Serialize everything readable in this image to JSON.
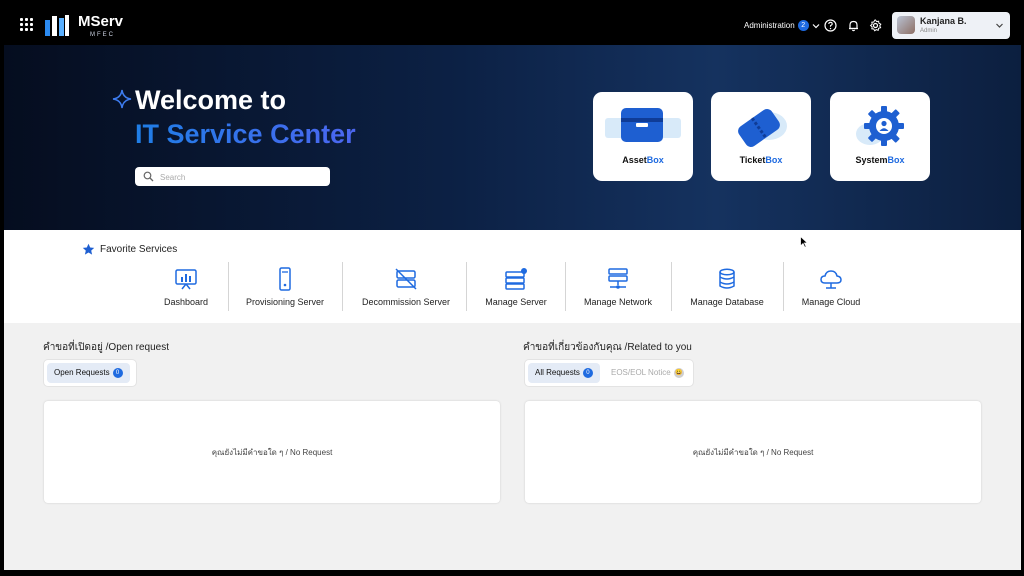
{
  "header": {
    "brand": "MServ",
    "brand_sub": "MFEC",
    "admin_label": "Administration",
    "admin_count": "2",
    "user_name": "Kanjana B.",
    "user_role": "Admin"
  },
  "hero": {
    "title_line1": "Welcome to",
    "title_line2": "IT Service Center",
    "search_placeholder": "Search",
    "boxes": [
      {
        "name": "Asset",
        "suffix": "Box"
      },
      {
        "name": "Ticket",
        "suffix": "Box"
      },
      {
        "name": "System",
        "suffix": "Box"
      }
    ]
  },
  "favorites": {
    "title": "Favorite Services",
    "items": [
      {
        "label": "Dashboard",
        "icon": "dashboard-icon"
      },
      {
        "label": "Provisioning Server",
        "icon": "server-icon"
      },
      {
        "label": "Decommission Server",
        "icon": "server-off-icon"
      },
      {
        "label": "Manage Server",
        "icon": "manage-server-icon"
      },
      {
        "label": "Manage Network",
        "icon": "network-icon"
      },
      {
        "label": "Manage Database",
        "icon": "database-icon"
      },
      {
        "label": "Manage Cloud",
        "icon": "cloud-icon"
      }
    ]
  },
  "open_requests": {
    "title": "คำขอที่เปิดอยู่ /Open request",
    "tab_label": "Open Requests",
    "tab_count": "0",
    "empty_text": "คุณยังไม่มีคำขอใด ๆ / No Request"
  },
  "related": {
    "title": "คำขอที่เกี่ยวข้องกับคุณ /Related to you",
    "tabs": [
      {
        "label": "All Requests",
        "count": "0"
      },
      {
        "label": "EOS/EOL Notice",
        "count": "😀"
      }
    ],
    "empty_text": "คุณยังไม่มีคำขอใด ๆ / No Request"
  },
  "colors": {
    "accent": "#1e6ae0",
    "hero_dark": "#050d1f",
    "hero_mid": "#15325f"
  }
}
